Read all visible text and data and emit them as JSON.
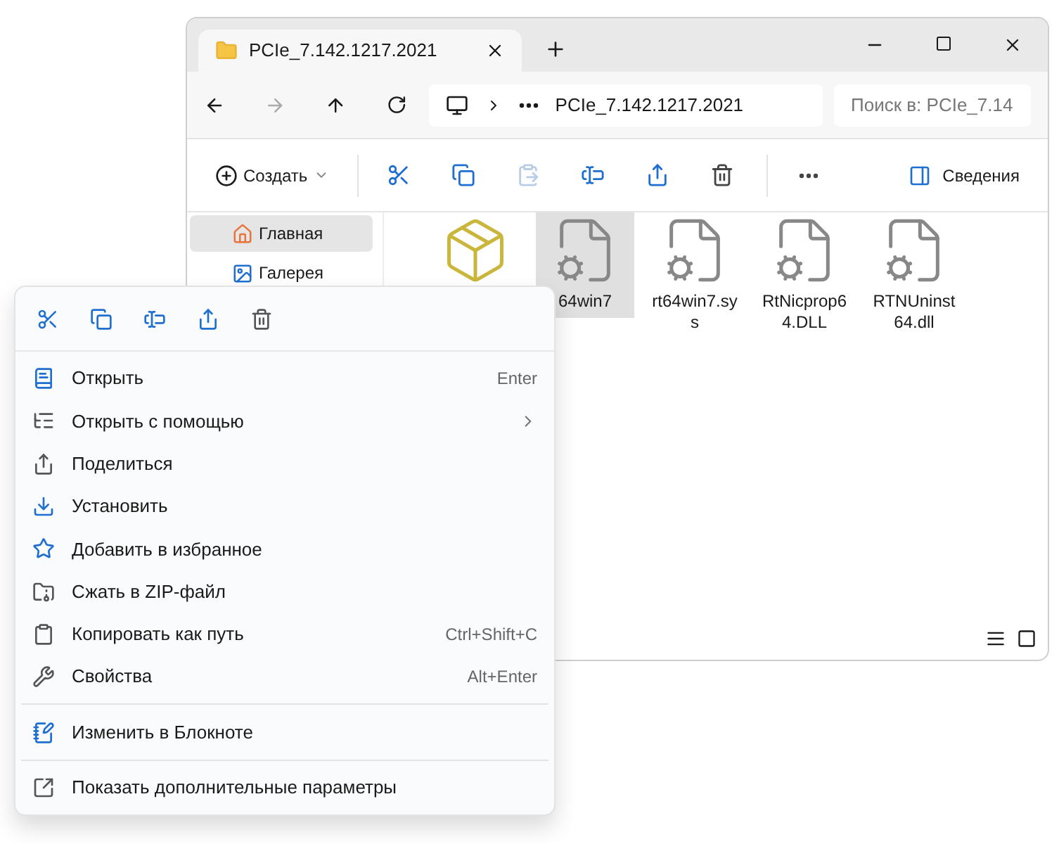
{
  "window": {
    "tab_title": "PCIe_7.142.1217.2021"
  },
  "address": {
    "path": "PCIe_7.142.1217.2021",
    "search_placeholder": "Поиск в: PCIe_7.14"
  },
  "toolbar": {
    "items": [
      {
        "kind": "create",
        "label": "Создать",
        "disabled": false
      },
      {
        "kind": "cut",
        "disabled": false
      },
      {
        "kind": "copy",
        "disabled": false
      },
      {
        "kind": "paste",
        "disabled": true
      },
      {
        "kind": "rename",
        "disabled": false
      },
      {
        "kind": "share",
        "disabled": false
      },
      {
        "kind": "delete",
        "disabled": false
      },
      {
        "kind": "more",
        "disabled": false
      }
    ],
    "details": "Сведения"
  },
  "sidebar": {
    "items": [
      {
        "kind": "home",
        "label": "Главная",
        "selected": true
      },
      {
        "kind": "gallery",
        "label": "Галерея",
        "selected": false
      }
    ]
  },
  "files": [
    {
      "kind": "setup",
      "selected": false
    },
    {
      "kind": "gear",
      "name": "64win7",
      "selected": true
    },
    {
      "kind": "gear-doc",
      "name": "rt64win7.sys",
      "selected": false
    },
    {
      "kind": "gear-doc",
      "name": "RtNicprop64.DLL",
      "selected": false
    },
    {
      "kind": "gear-doc",
      "name": "RTNUninst64.dll",
      "selected": false
    }
  ],
  "context_menu": {
    "actions": [
      {
        "kind": "cut"
      },
      {
        "kind": "copy"
      },
      {
        "kind": "rename"
      },
      {
        "kind": "share"
      },
      {
        "kind": "delete"
      }
    ],
    "groups": [
      [
        {
          "kind": "open",
          "label": "Открыть",
          "shortcut": "Enter",
          "submenu": false
        },
        {
          "kind": "open-with",
          "label": "Открыть с помощью",
          "submenu": true
        },
        {
          "kind": "share",
          "label": "Поделиться",
          "submenu": false
        },
        {
          "kind": "install",
          "label": "Установить",
          "submenu": false
        },
        {
          "kind": "favorite",
          "label": "Добавить в избранное",
          "submenu": false
        },
        {
          "kind": "zip",
          "label": "Сжать в ZIP-файл",
          "submenu": false
        },
        {
          "kind": "copy-path",
          "label": "Копировать как путь",
          "shortcut": "Ctrl+Shift+C",
          "submenu": false
        },
        {
          "kind": "properties",
          "label": "Свойства",
          "shortcut": "Alt+Enter",
          "submenu": false
        }
      ],
      [
        {
          "kind": "notepad",
          "label": "Изменить в Блокноте",
          "submenu": false
        }
      ],
      [
        {
          "kind": "more-options",
          "label": "Показать дополнительные параметры",
          "submenu": false
        }
      ]
    ]
  }
}
